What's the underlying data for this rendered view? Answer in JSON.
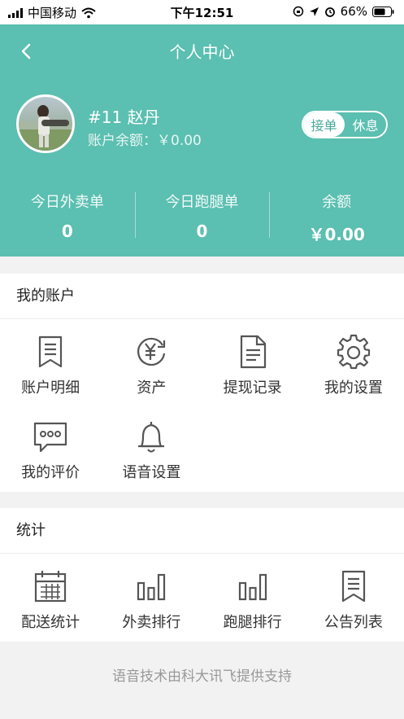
{
  "status_bar": {
    "carrier": "中国移动",
    "time": "下午12:51",
    "battery": "66%"
  },
  "nav": {
    "title": "个人中心"
  },
  "user": {
    "name": "#11 赵丹",
    "balance_text": "账户余额：￥0.00"
  },
  "toggle": {
    "on_label": "接单",
    "off_label": "休息"
  },
  "stats": [
    {
      "label": "今日外卖单",
      "value": "0"
    },
    {
      "label": "今日跑腿单",
      "value": "0"
    },
    {
      "label": "余额",
      "value": "￥0.00"
    }
  ],
  "account": {
    "title": "我的账户",
    "items": [
      {
        "label": "账户明细",
        "icon": "bookmark-list-icon"
      },
      {
        "label": "资产",
        "icon": "yuan-refresh-icon"
      },
      {
        "label": "提现记录",
        "icon": "document-icon"
      },
      {
        "label": "我的设置",
        "icon": "gear-icon"
      },
      {
        "label": "我的评价",
        "icon": "comment-icon"
      },
      {
        "label": "语音设置",
        "icon": "bell-icon"
      }
    ]
  },
  "statistics": {
    "title": "统计",
    "items": [
      {
        "label": "配送统计",
        "icon": "calendar-icon"
      },
      {
        "label": "外卖排行",
        "icon": "bar-chart-icon"
      },
      {
        "label": "跑腿排行",
        "icon": "bar-chart-icon"
      },
      {
        "label": "公告列表",
        "icon": "bookmark-list-icon"
      }
    ]
  },
  "footer": {
    "text": "语音技术由科大讯飞提供支持"
  },
  "colors": {
    "brand": "#5bbfb1",
    "icon": "#555555"
  }
}
